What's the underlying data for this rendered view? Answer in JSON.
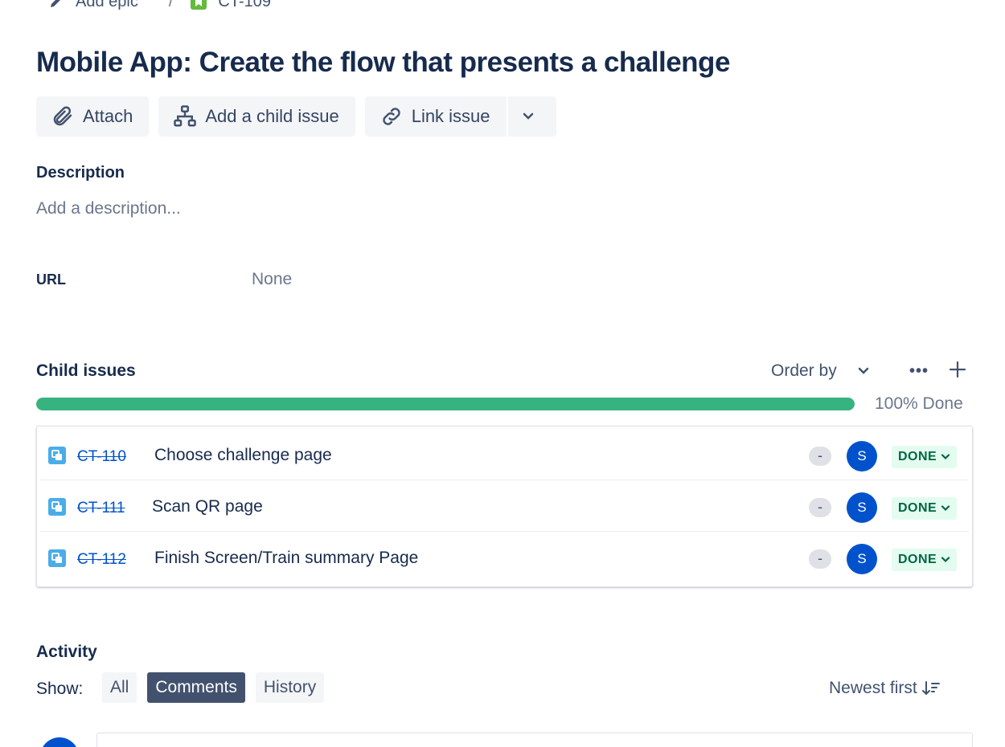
{
  "breadcrumb": {
    "parent_label": "Add epic",
    "separator": "/",
    "issue_key": "CT-109"
  },
  "issue": {
    "title": "Mobile App: Create the flow that presents a challenge"
  },
  "toolbar": {
    "attach_label": "Attach",
    "add_child_label": "Add a child issue",
    "link_issue_label": "Link issue"
  },
  "description": {
    "heading": "Description",
    "placeholder": "Add a description..."
  },
  "fields": {
    "url_label": "URL",
    "url_value": "None"
  },
  "child_issues": {
    "heading": "Child issues",
    "order_by_label": "Order by",
    "more_label": "•••",
    "progress_percent": 100,
    "progress_text": "100% Done",
    "items": [
      {
        "key": "CT-110",
        "summary": "Choose challenge page",
        "priority": "-",
        "assignee_initial": "S",
        "status": "DONE"
      },
      {
        "key": "CT-111",
        "summary": "Scan QR page",
        "priority": "-",
        "assignee_initial": "S",
        "status": "DONE"
      },
      {
        "key": "CT-112",
        "summary": "Finish Screen/Train summary Page",
        "priority": "-",
        "assignee_initial": "S",
        "status": "DONE"
      }
    ]
  },
  "activity": {
    "heading": "Activity",
    "show_label": "Show:",
    "tabs": [
      {
        "label": "All",
        "active": false
      },
      {
        "label": "Comments",
        "active": true
      },
      {
        "label": "History",
        "active": false
      }
    ],
    "sort_label": "Newest first"
  },
  "colors": {
    "progress_green": "#36b37e",
    "status_done_bg": "#e3fcef",
    "status_done_text": "#006644",
    "avatar_blue": "#0052cc",
    "subtask_blue": "#4bade8",
    "story_green": "#63ba3c"
  },
  "icons": {
    "attach": "paperclip-icon",
    "add_child": "hierarchy-icon",
    "link": "link-icon",
    "more": "chevron-down-icon",
    "sort": "sort-descending-icon"
  }
}
